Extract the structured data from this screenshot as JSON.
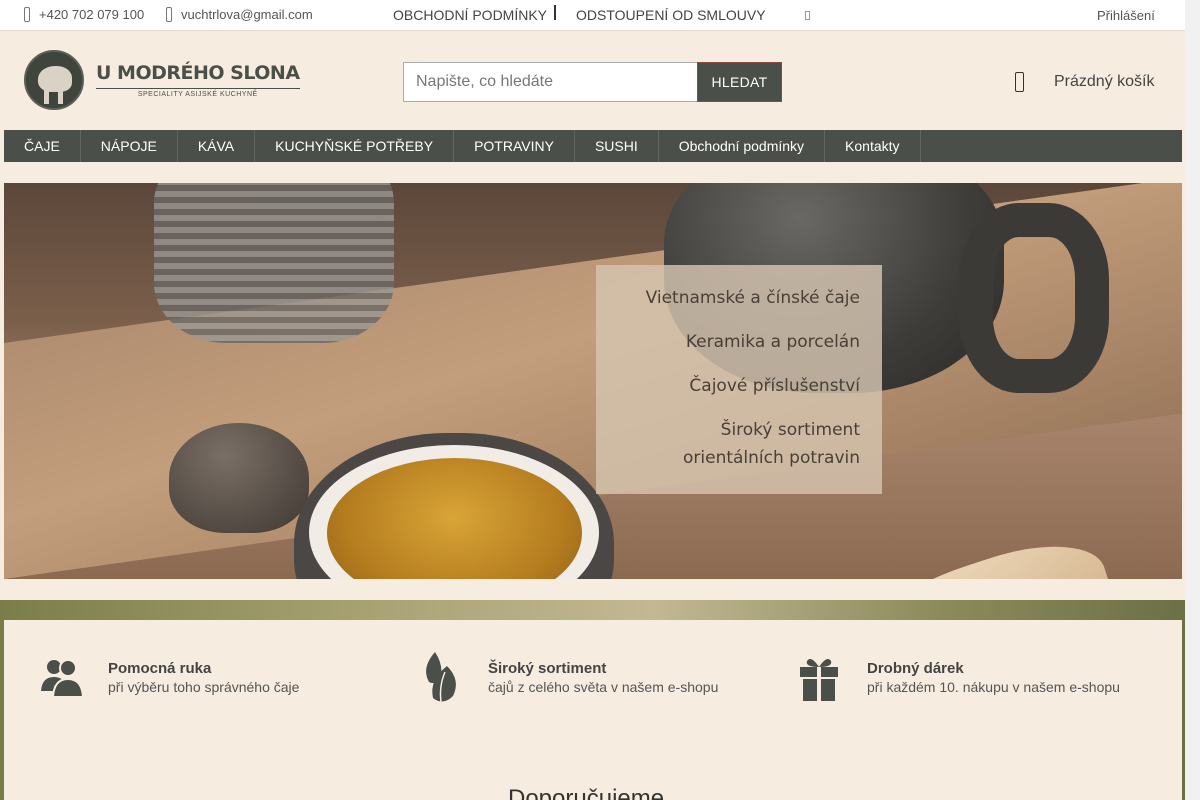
{
  "topbar": {
    "phone": "+420 702 079 100",
    "email": "vuchtrlova@gmail.com",
    "terms_link": "OBCHODNÍ PODMÍNKY",
    "withdrawal_link": "ODSTOUPENÍ OD SMLOUVY",
    "login": "Přihlášení",
    "phone_icon": "phone-icon",
    "email_icon": "envelope-icon"
  },
  "header": {
    "logo_title": "U MODRÉHO SLONA",
    "logo_subtitle": "SPECIALITY ASIJSKÉ KUCHYNĚ",
    "search_placeholder": "Napište, co hledáte",
    "search_button": "HLEDAT",
    "cart_label": "Prázdný košík"
  },
  "nav": {
    "items": [
      "ČAJE",
      "NÁPOJE",
      "KÁVA",
      "KUCHYŇSKÉ POTŘEBY",
      "POTRAVINY",
      "SUSHI",
      "Obchodní podmínky",
      "Kontakty"
    ]
  },
  "hero": {
    "lines": [
      "Vietnamské a čínské čaje",
      "Keramika a porcelán",
      "Čajové příslušenství",
      "Široký sortiment",
      "orientálních potravin"
    ]
  },
  "features": [
    {
      "title": "Pomocná ruka",
      "subtitle": "při výběru toho správného čaje",
      "icon": "people-icon"
    },
    {
      "title": "Široký sortiment",
      "subtitle": "čajů z celého světa v našem e-shopu",
      "icon": "leaves-icon"
    },
    {
      "title": "Drobný dárek",
      "subtitle": "při každém 10. nákupu v našem e-shopu",
      "icon": "gift-icon"
    }
  ],
  "section_heading": "Doporučujeme",
  "colors": {
    "nav_bg": "#4b4f49",
    "page_bg": "#f6ede0",
    "button_border": "#8c4a3a"
  }
}
